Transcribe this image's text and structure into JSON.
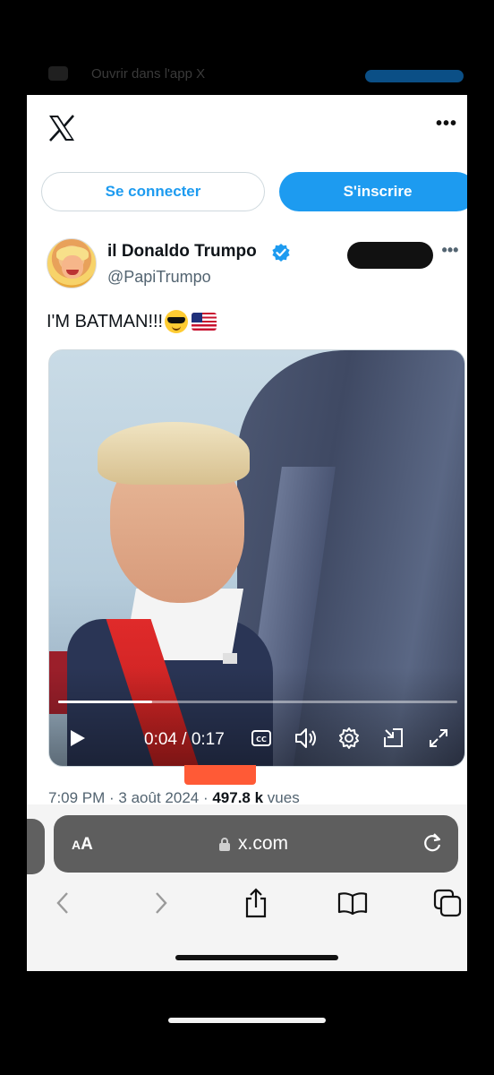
{
  "banner": {
    "text": "Ouvrir dans l'app X"
  },
  "header": {
    "logo": "x-logo",
    "more_icon": "more-horizontal-icon",
    "more_label": "•••"
  },
  "auth": {
    "login_label": "Se connecter",
    "signup_label": "S'inscrire"
  },
  "tweet": {
    "display_name": "il Donaldo Trumpo",
    "handle": "@PapiTrumpo",
    "verified": true,
    "text": "I'M BATMAN!!!",
    "emojis": [
      "sunglasses-emoji",
      "us-flag-emoji"
    ],
    "more_label": "•••",
    "video": {
      "current_time": "0:04",
      "duration": "0:17",
      "time_display": "0:04 / 0:17",
      "progress_fraction": 0.235,
      "controls": [
        "play-icon",
        "captions-icon",
        "volume-icon",
        "settings-icon",
        "pip-icon",
        "fullscreen-icon"
      ]
    },
    "timestamp": "7:09 PM · 3 août 2024 · ",
    "views_count": "497.8 k",
    "views_label": " vues"
  },
  "browser": {
    "text_size_label": "AA",
    "url": "x.com",
    "nav_icons": [
      "back-icon",
      "forward-icon",
      "share-icon",
      "bookmarks-icon",
      "tabs-icon"
    ]
  },
  "colors": {
    "accent": "#1d9bf0",
    "text": "#0f1419",
    "muted": "#536471"
  }
}
